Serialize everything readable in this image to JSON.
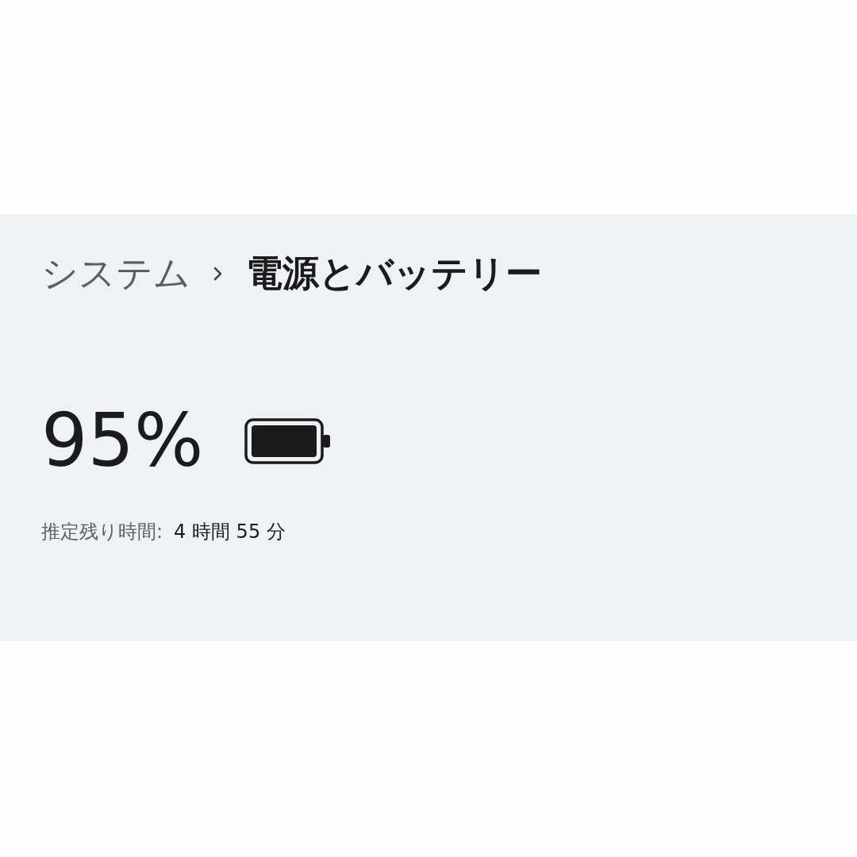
{
  "breadcrumb": {
    "parent": "システム",
    "current": "電源とバッテリー"
  },
  "battery": {
    "percent": "95%"
  },
  "remaining": {
    "label": "推定残り時間:",
    "value": "4 時間 55 分"
  }
}
